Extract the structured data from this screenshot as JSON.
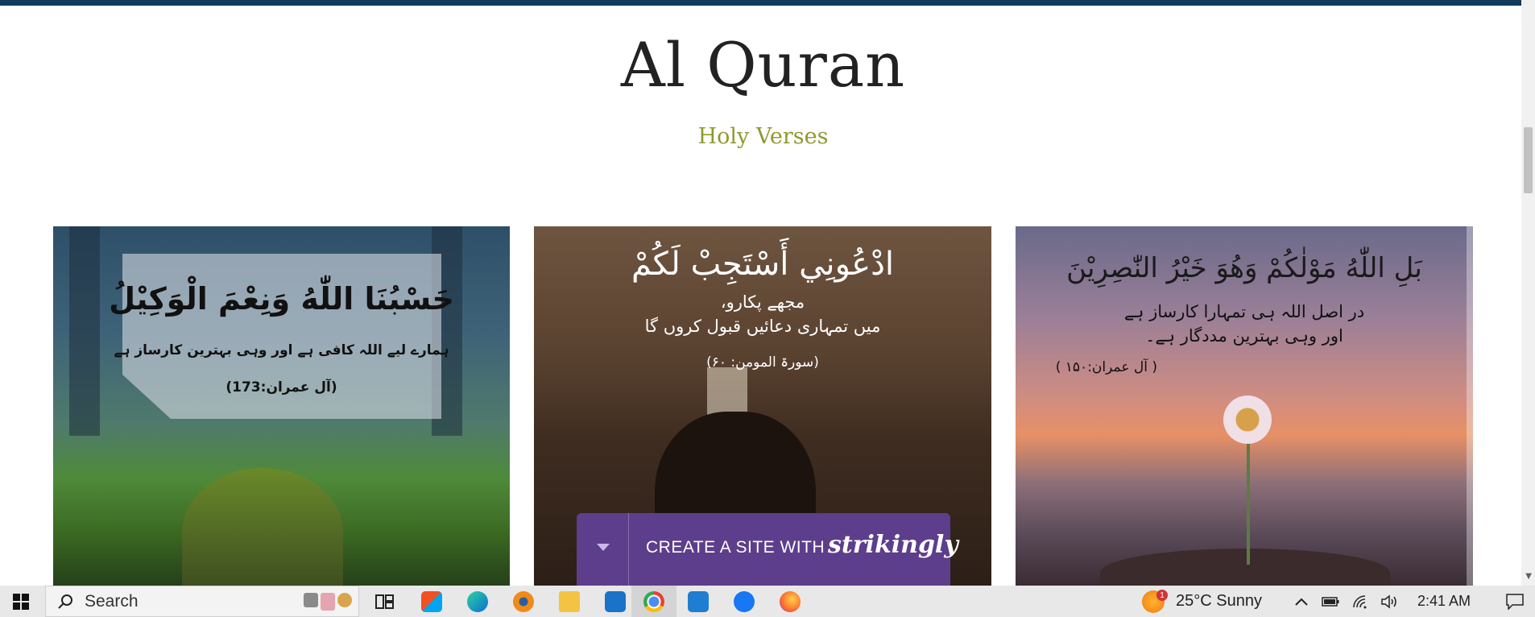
{
  "header": {
    "title": "Al Quran",
    "subtitle": "Holy Verses"
  },
  "cards": [
    {
      "arabic": "حَسْبُنَا اللّٰهُ وَنِعْمَ الْوَكِيْلُ",
      "urdu": "ہمارے لیے اللہ کافی ہے اور وہی بہترین کارساز ہے",
      "reference": "(آل عمران:173)"
    },
    {
      "arabic": "ادْعُونِي أَسْتَجِبْ لَكُمْ",
      "urdu_1": "مجھے پکارو،",
      "urdu_2": "میں تمہاری دعائیں قبول کروں گا",
      "reference": "(سورۃ المومن: ۶۰)"
    },
    {
      "arabic": "بَلِ اللّٰهُ مَوْلٰكُمْ وَهُوَ خَيْرُ النّٰصِرِيْنَ",
      "urdu_1": "در اصل اللہ ہی تمہارا کارساز ہے",
      "urdu_2": "اور وہی بہترین مددگار ہے۔",
      "reference": "( آل عمران:۱۵۰ )"
    }
  ],
  "banner": {
    "text": "CREATE A SITE WITH",
    "brand": "strikingly"
  },
  "taskbar": {
    "search_label": "Search",
    "weather": "25°C  Sunny",
    "weather_badge": "1",
    "time": "2:41 AM",
    "icons": [
      "windows-icon",
      "search-icon",
      "task-view-icon",
      "store-icon",
      "edge-icon",
      "blender-icon",
      "file-explorer-icon",
      "mail-icon",
      "chrome-icon",
      "vscode-icon",
      "facebook-icon",
      "firefox-icon"
    ]
  },
  "colors": {
    "top_bar": "#123a5a",
    "subtitle": "#8f9a2e",
    "banner": "#5d3e8c"
  }
}
